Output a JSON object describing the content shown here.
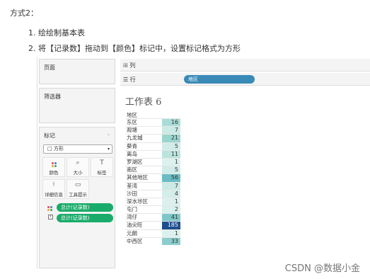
{
  "doc": {
    "heading": "方式2：",
    "steps": [
      "1. 绘绘制基本表",
      "2. 将【记录数】拖动到【颜色】标记中，设置标记格式为方形"
    ]
  },
  "ui": {
    "pages_label": "页面",
    "filters_label": "筛选器",
    "marks_label": "标记",
    "mark_type": "□ 方形",
    "mark_buttons": [
      "颜色",
      "大小",
      "标签",
      "详细信息",
      "工具提示"
    ],
    "pills": [
      "总计(记录数)",
      "总计(记录数)"
    ],
    "columns_label": "iii 列",
    "rows_label": "☰ 行",
    "rows_pill": "地区",
    "sheet_title": "工作表 6",
    "column_header": "地区"
  },
  "table": {
    "rows": [
      {
        "label": "东区",
        "value": "16",
        "color": "#a9dcd6"
      },
      {
        "label": "观塘",
        "value": "7",
        "color": "#cbeae5"
      },
      {
        "label": "九龙城",
        "value": "21",
        "color": "#9ad5cf"
      },
      {
        "label": "葵青",
        "value": "5",
        "color": "#d1ece8"
      },
      {
        "label": "离岛",
        "value": "11",
        "color": "#bbe3dd"
      },
      {
        "label": "罗湖区",
        "value": "1",
        "color": "#dcf1ee"
      },
      {
        "label": "南区",
        "value": "5",
        "color": "#d1ece8"
      },
      {
        "label": "其他地区",
        "value": "56",
        "color": "#6bbcc4"
      },
      {
        "label": "荃湾",
        "value": "7",
        "color": "#cbeae5"
      },
      {
        "label": "沙田",
        "value": "4",
        "color": "#d4eee9"
      },
      {
        "label": "深水埗区",
        "value": "1",
        "color": "#dcf1ee"
      },
      {
        "label": "屯门",
        "value": "2",
        "color": "#d9f0ec"
      },
      {
        "label": "湾仔",
        "value": "41",
        "color": "#7ec7c9"
      },
      {
        "label": "油尖旺",
        "value": "185",
        "color": "#1f4e8c",
        "text_color": "#ffffff"
      },
      {
        "label": "元朗",
        "value": "1",
        "color": "#dcf1ee"
      },
      {
        "label": "中西区",
        "value": "33",
        "color": "#8bcdcc"
      }
    ]
  },
  "watermark": "CSDN @数据小金",
  "colors": {
    "pill_green": "#1aab6a",
    "pill_blue": "#3a8ab8"
  }
}
